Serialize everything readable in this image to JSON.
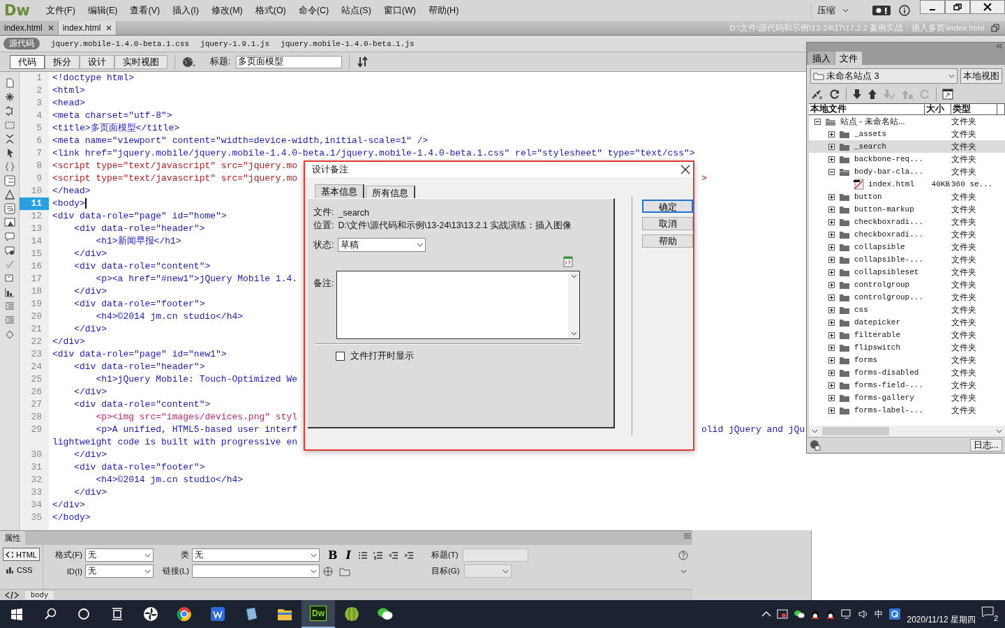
{
  "app": {
    "logo": "Dw",
    "menu": [
      "文件(F)",
      "编辑(E)",
      "查看(V)",
      "插入(I)",
      "修改(M)",
      "格式(O)",
      "命令(C)",
      "站点(S)",
      "窗口(W)",
      "帮助(H)"
    ],
    "workspace": "压缩"
  },
  "doc_tabs": [
    {
      "label": "index.html",
      "selected": false
    },
    {
      "label": "index.html",
      "selected": true
    }
  ],
  "doc_path": "D:\\文件\\源代码和示例\\13-24\\17\\17.2.2  案例实战：插入多页\\index.html",
  "related_files": [
    {
      "label": "源代码",
      "selected": true
    },
    {
      "label": "jquery.mobile-1.4.0-beta.1.css",
      "selected": false
    },
    {
      "label": "jquery-1.9.1.js",
      "selected": false
    },
    {
      "label": "jquery.mobile-1.4.0-beta.1.js",
      "selected": false
    }
  ],
  "view_buttons": [
    {
      "label": "代码",
      "selected": true
    },
    {
      "label": "拆分",
      "selected": false
    },
    {
      "label": "设计",
      "selected": false
    },
    {
      "label": "实时视图",
      "selected": false
    }
  ],
  "title_field": {
    "label": "标题:",
    "value": "多页面模型"
  },
  "code_lines": [
    {
      "number": "1",
      "text": "<!doctype html>",
      "kind": "tag",
      "current": false
    },
    {
      "number": "2",
      "text": "<html>",
      "kind": "tag",
      "current": false
    },
    {
      "number": "3",
      "text": "<head>",
      "kind": "tag",
      "current": false
    },
    {
      "number": "4",
      "text": "<meta charset=\"utf-8\">",
      "kind": "tag",
      "current": false
    },
    {
      "number": "5",
      "text": "<title>多页面模型</title>",
      "kind": "tag",
      "current": false
    },
    {
      "number": "6",
      "text": "<meta name=\"viewport\" content=\"width=device-width,initial-scale=1\" />",
      "kind": "tag",
      "current": false
    },
    {
      "number": "7",
      "text": "<link href=\"jquery.mobile/jquery.mobile-1.4.0-beta.1/jquery.mobile-1.4.0-beta.1.css\" rel=\"stylesheet\" type=\"text/css\">",
      "kind": "tag",
      "current": false
    },
    {
      "number": "8",
      "text": "<script type=\"text/javascript\" src=\"jquery.mo",
      "kind": "script",
      "current": false
    },
    {
      "number": "9",
      "text": "<script type=\"text/javascript\" src=\"jquery.mo",
      "tail": ">",
      "kind": "script",
      "current": false
    },
    {
      "number": "10",
      "text": "</head>",
      "kind": "tag",
      "current": false
    },
    {
      "number": "11",
      "text": "<body>",
      "kind": "tag",
      "current": true
    },
    {
      "number": "12",
      "text": "<div data-role=\"page\" id=\"home\">",
      "kind": "tag",
      "current": false
    },
    {
      "number": "13",
      "text": "    <div data-role=\"header\">",
      "kind": "tag",
      "current": false
    },
    {
      "number": "14",
      "text": "        <h1>新闻早报</h1>",
      "kind": "tag",
      "current": false
    },
    {
      "number": "15",
      "text": "    </div>",
      "kind": "tag",
      "current": false
    },
    {
      "number": "16",
      "text": "    <div data-role=\"content\">",
      "kind": "tag",
      "current": false
    },
    {
      "number": "17",
      "text": "        <p><a href=\"#new1\">jQuery Mobile 1.4.",
      "kind": "tag",
      "current": false
    },
    {
      "number": "18",
      "text": "    </div>",
      "kind": "tag",
      "current": false
    },
    {
      "number": "19",
      "text": "    <div data-role=\"footer\">",
      "kind": "tag",
      "current": false
    },
    {
      "number": "20",
      "text": "        <h4>©2014 jm.cn studio</h4>",
      "kind": "tag",
      "current": false
    },
    {
      "number": "21",
      "text": "    </div>",
      "kind": "tag",
      "current": false
    },
    {
      "number": "22",
      "text": "</div>",
      "kind": "tag",
      "current": false
    },
    {
      "number": "23",
      "text": "<div data-role=\"page\" id=\"new1\">",
      "kind": "tag",
      "current": false
    },
    {
      "number": "24",
      "text": "    <div data-role=\"header\">",
      "kind": "tag",
      "current": false
    },
    {
      "number": "25",
      "text": "        <h1>jQuery Mobile: Touch-Optimized We",
      "kind": "tag",
      "current": false
    },
    {
      "number": "26",
      "text": "    </div>",
      "kind": "tag",
      "current": false
    },
    {
      "number": "27",
      "text": "    <div data-role=\"content\">",
      "kind": "tag",
      "current": false
    },
    {
      "number": "28",
      "text": "        <p><img src=\"images/devices.png\" styl",
      "kind": "img",
      "current": false
    },
    {
      "number": "29",
      "text": "        <p>A unified, HTML5-based user interf",
      "tail": "olid jQuery and jQu",
      "wrap": "lightweight code is built with progressive en",
      "kind": "tag",
      "current": false
    },
    {
      "number": "30",
      "text": "    </div>",
      "kind": "tag",
      "current": false
    },
    {
      "number": "31",
      "text": "    <div data-role=\"footer\">",
      "kind": "tag",
      "current": false
    },
    {
      "number": "32",
      "text": "        <h4>©2014 jm.cn studio</h4>",
      "kind": "tag",
      "current": false
    },
    {
      "number": "33",
      "text": "    </div>",
      "kind": "tag",
      "current": false
    },
    {
      "number": "34",
      "text": "</div>",
      "kind": "tag",
      "current": false
    },
    {
      "number": "35",
      "text": "</body>",
      "kind": "tag",
      "current": false
    }
  ],
  "dialog": {
    "title": "设计备注",
    "tabs": [
      {
        "label": "基本信息",
        "selected": true
      },
      {
        "label": "所有信息",
        "selected": false
      }
    ],
    "file_label": "文件:",
    "file": "_search",
    "location_label": "位置:",
    "location": "D:\\文件\\源代码和示例\\13-24\\13\\13.2.1 实战演练：插入图像",
    "status_label": "状态:",
    "status": "草稿",
    "notes_label": "备注:",
    "show_on_open": {
      "label": "文件打开时显示",
      "checked": false
    },
    "buttons": [
      {
        "label": "确定",
        "selected": true
      },
      {
        "label": "取消",
        "selected": false
      },
      {
        "label": "帮助",
        "selected": false
      }
    ]
  },
  "files_panel": {
    "tabs": [
      {
        "label": "插入",
        "selected": false
      },
      {
        "label": "文件",
        "selected": true
      }
    ],
    "site": "未命名站点 3",
    "view": "本地视图",
    "columns": [
      "本地文件",
      "大小",
      "类型"
    ],
    "tree": [
      {
        "name": "站点 - 未命名站...",
        "type": "文件夹",
        "kind": "site",
        "expanded": true,
        "selected": false,
        "children": [
          {
            "name": "_assets",
            "type": "文件夹",
            "kind": "folder",
            "expanded": false,
            "selected": false
          },
          {
            "name": "_search",
            "type": "文件夹",
            "kind": "folder",
            "expanded": false,
            "selected": true
          },
          {
            "name": "backbone-req...",
            "type": "文件夹",
            "kind": "folder",
            "expanded": false,
            "selected": false
          },
          {
            "name": "body-bar-cla...",
            "type": "文件夹",
            "kind": "folder",
            "expanded": true,
            "selected": false,
            "children": [
              {
                "name": "index.html",
                "size": "40KB",
                "type": "360 se...",
                "kind": "file",
                "selected": false
              }
            ]
          },
          {
            "name": "button",
            "type": "文件夹",
            "kind": "folder",
            "expanded": false,
            "selected": false
          },
          {
            "name": "button-markup",
            "type": "文件夹",
            "kind": "folder",
            "expanded": false,
            "selected": false
          },
          {
            "name": "checkboxradi...",
            "type": "文件夹",
            "kind": "folder",
            "expanded": false,
            "selected": false
          },
          {
            "name": "checkboxradi...",
            "type": "文件夹",
            "kind": "folder",
            "expanded": false,
            "selected": false
          },
          {
            "name": "collapsible",
            "type": "文件夹",
            "kind": "folder",
            "expanded": false,
            "selected": false
          },
          {
            "name": "collapsible-...",
            "type": "文件夹",
            "kind": "folder",
            "expanded": false,
            "selected": false
          },
          {
            "name": "collapsibleset",
            "type": "文件夹",
            "kind": "folder",
            "expanded": false,
            "selected": false
          },
          {
            "name": "controlgroup",
            "type": "文件夹",
            "kind": "folder",
            "expanded": false,
            "selected": false
          },
          {
            "name": "controlgroup...",
            "type": "文件夹",
            "kind": "folder",
            "expanded": false,
            "selected": false
          },
          {
            "name": "css",
            "type": "文件夹",
            "kind": "folder",
            "expanded": false,
            "selected": false
          },
          {
            "name": "datepicker",
            "type": "文件夹",
            "kind": "folder",
            "expanded": false,
            "selected": false
          },
          {
            "name": "filterable",
            "type": "文件夹",
            "kind": "folder",
            "expanded": false,
            "selected": false
          },
          {
            "name": "flipswitch",
            "type": "文件夹",
            "kind": "folder",
            "expanded": false,
            "selected": false
          },
          {
            "name": "forms",
            "type": "文件夹",
            "kind": "folder",
            "expanded": false,
            "selected": false
          },
          {
            "name": "forms-disabled",
            "type": "文件夹",
            "kind": "folder",
            "expanded": false,
            "selected": false
          },
          {
            "name": "forms-field-...",
            "type": "文件夹",
            "kind": "folder",
            "expanded": false,
            "selected": false
          },
          {
            "name": "forms-gallery",
            "type": "文件夹",
            "kind": "folder",
            "expanded": false,
            "selected": false
          },
          {
            "name": "forms-label-...",
            "type": "文件夹",
            "kind": "folder",
            "expanded": false,
            "selected": false
          }
        ]
      }
    ],
    "log_button": "日志..."
  },
  "properties": {
    "title": "属性",
    "modes": [
      {
        "label": "HTML",
        "selected": true
      },
      {
        "label": "CSS",
        "selected": false
      }
    ],
    "format_label": "格式(F)",
    "format": "无",
    "id_label": "ID(I)",
    "id": "无",
    "class_label": "类",
    "class": "无",
    "link_label": "链接(L)",
    "bold": "B",
    "italic": "I",
    "heading_label": "标题(T)",
    "target_label": "目标(G)"
  },
  "tag_selector": {
    "tag": "body"
  },
  "taskbar": {
    "apps": [
      {
        "kind": "pinwheel",
        "active": false
      },
      {
        "kind": "chrome",
        "active": false
      },
      {
        "kind": "wps",
        "active": false
      },
      {
        "kind": "book",
        "active": false
      },
      {
        "kind": "folder",
        "active": false
      },
      {
        "kind": "dw",
        "label": "Dw",
        "active": true
      },
      {
        "kind": "melon",
        "active": false
      },
      {
        "kind": "wechat",
        "active": false
      }
    ],
    "ime": "中",
    "date": "2020/11/12 星期四",
    "notifications": "2"
  }
}
